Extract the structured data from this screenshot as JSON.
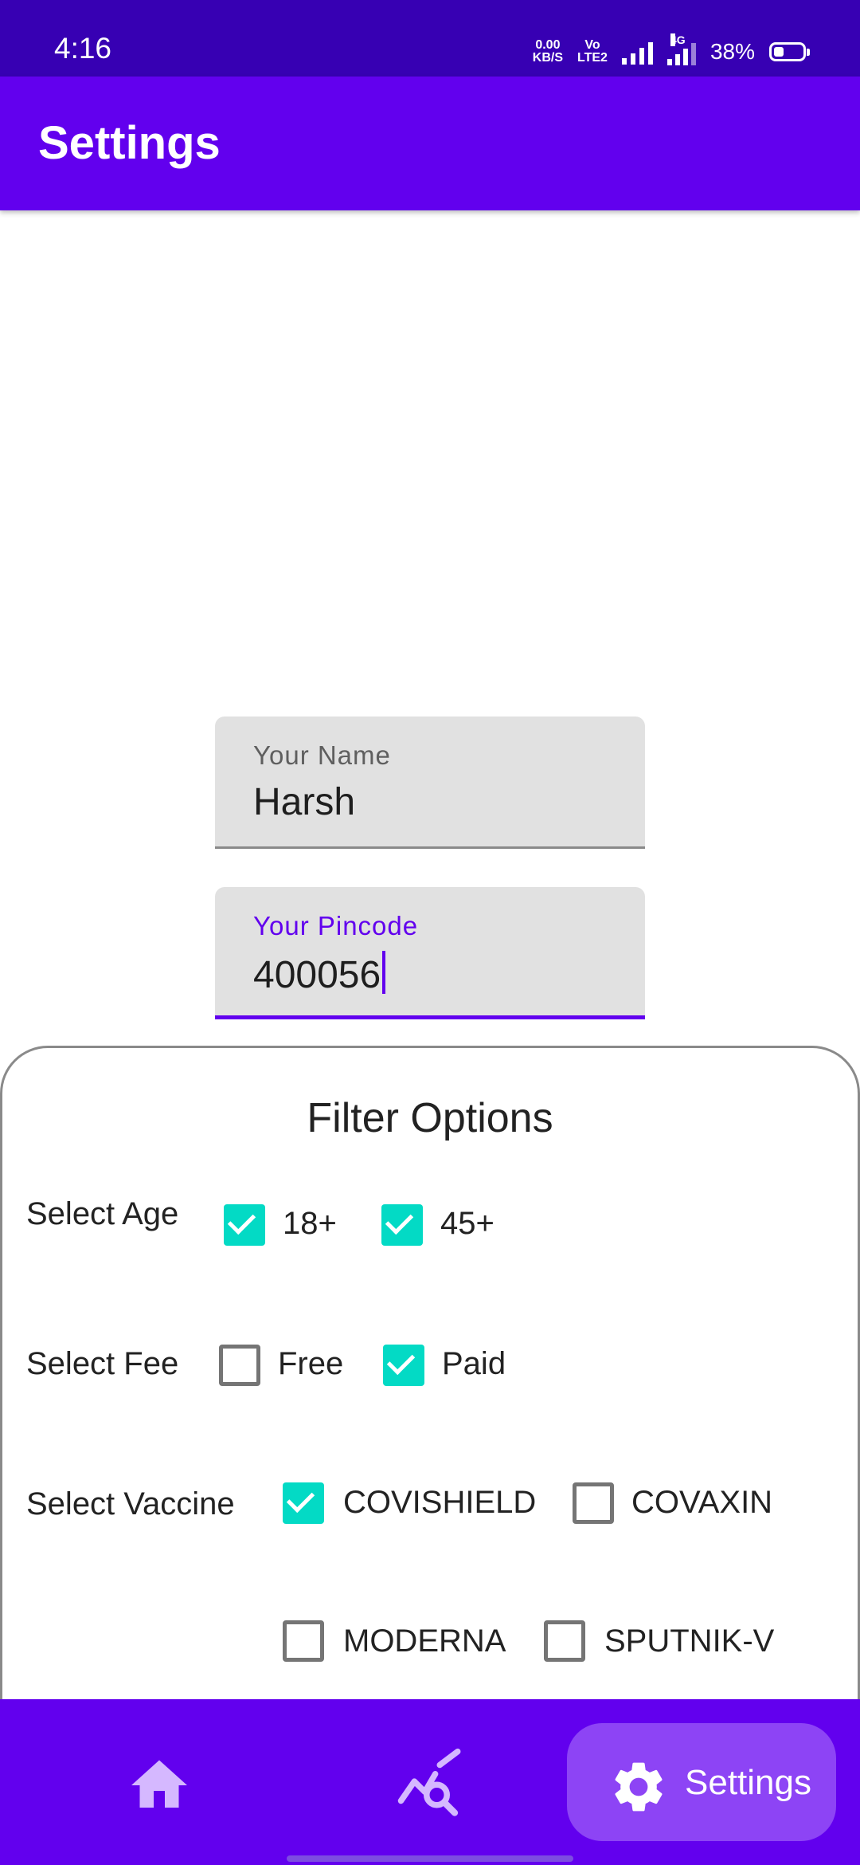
{
  "status_bar": {
    "time": "4:16",
    "net_speed_value": "0.00",
    "net_speed_unit": "KB/S",
    "volte_line1": "Vo",
    "volte_line2": "LTE2",
    "network_tag": "4G",
    "battery": "38%"
  },
  "app_bar": {
    "title": "Settings"
  },
  "form": {
    "name_label": "Your Name",
    "name_value": "Harsh",
    "pincode_label": "Your Pincode",
    "pincode_value": "400056"
  },
  "filter": {
    "heading": "Filter Options",
    "age": {
      "label": "Select Age",
      "options": [
        {
          "text": "18+",
          "checked": true
        },
        {
          "text": "45+",
          "checked": true
        }
      ]
    },
    "fee": {
      "label": "Select Fee",
      "options": [
        {
          "text": "Free",
          "checked": false
        },
        {
          "text": "Paid",
          "checked": true
        }
      ]
    },
    "vaccine": {
      "label": "Select Vaccine",
      "options": [
        {
          "text": "COVISHIELD",
          "checked": true
        },
        {
          "text": "COVAXIN",
          "checked": false
        },
        {
          "text": "MODERNA",
          "checked": false
        },
        {
          "text": "SPUTNIK-V",
          "checked": false
        }
      ]
    }
  },
  "bottom_nav": {
    "items": [
      {
        "icon": "home-icon"
      },
      {
        "icon": "stats-search-icon"
      },
      {
        "icon": "gear-icon",
        "label": "Settings",
        "active": true
      }
    ]
  },
  "colors": {
    "status_bar": "#3700b3",
    "primary": "#6200ee",
    "checkbox_checked": "#03dac5",
    "nav_active_pill": "#8d44f5"
  }
}
